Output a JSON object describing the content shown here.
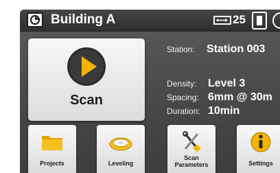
{
  "header": {
    "title": "Building A",
    "file_count": "25",
    "icons": [
      "building-scan-icon",
      "usb-drive-icon",
      "battery-icon",
      "clock-icon"
    ]
  },
  "scan_button": {
    "label": "Scan",
    "icon": "play-icon"
  },
  "station": {
    "label": "Station:",
    "value": "Station 003"
  },
  "density": {
    "label": "Density:",
    "value": "Level 3"
  },
  "spacing": {
    "label": "Spacing:",
    "value": "6mm @ 30m"
  },
  "duration": {
    "label": "Duration:",
    "value": "10min"
  },
  "toolbar": {
    "projects": "Projects",
    "leveling": "Leveling",
    "scan_parameters_line1": "Scan",
    "scan_parameters_line2": "Parameters",
    "settings": "Settings"
  },
  "colors": {
    "accent": "#f5b400",
    "background": "#474747",
    "header": "#2f2f2f"
  }
}
